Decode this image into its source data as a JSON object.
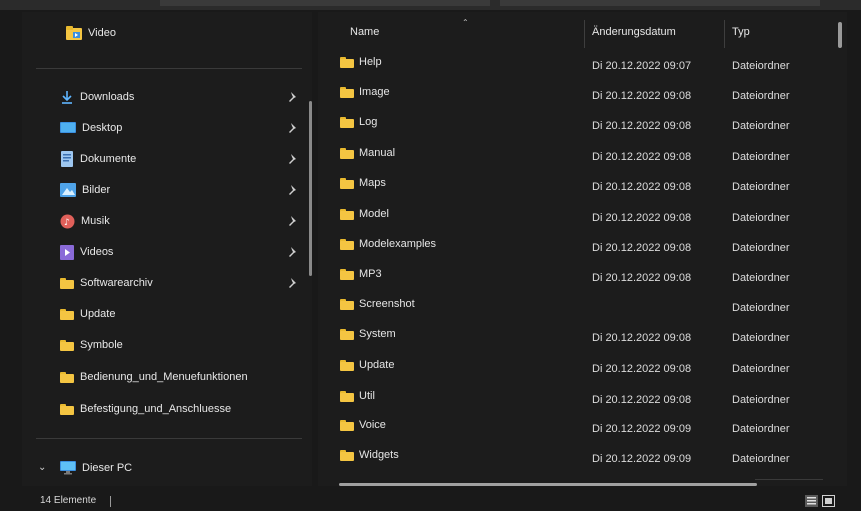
{
  "nav": {
    "top_item": {
      "label": "Video",
      "icon": "video-folder-icon"
    },
    "quick_access": [
      {
        "label": "Downloads",
        "icon": "download-arrow-icon",
        "pinned": true
      },
      {
        "label": "Desktop",
        "icon": "desktop-icon",
        "pinned": true
      },
      {
        "label": "Dokumente",
        "icon": "document-icon",
        "pinned": true
      },
      {
        "label": "Bilder",
        "icon": "pictures-icon",
        "pinned": true
      },
      {
        "label": "Musik",
        "icon": "music-icon",
        "pinned": true
      },
      {
        "label": "Videos",
        "icon": "videos-icon",
        "pinned": true
      },
      {
        "label": "Softwarearchiv",
        "icon": "folder-icon",
        "pinned": true
      },
      {
        "label": "Update",
        "icon": "folder-icon",
        "pinned": false
      },
      {
        "label": "Symbole",
        "icon": "folder-icon",
        "pinned": false
      },
      {
        "label": "Bedienung_und_Menuefunktionen",
        "icon": "folder-icon",
        "pinned": false
      },
      {
        "label": "Befestigung_und_Anschluesse",
        "icon": "folder-icon",
        "pinned": false
      }
    ],
    "this_pc": {
      "label": "Dieser PC",
      "icon": "computer-icon",
      "expanded": true
    }
  },
  "columns": {
    "name": "Name",
    "date": "Änderungsdatum",
    "type": "Typ"
  },
  "files": [
    {
      "name": "Help",
      "date": "Di 20.12.2022 09:07",
      "type": "Dateiordner"
    },
    {
      "name": "Image",
      "date": "Di 20.12.2022 09:08",
      "type": "Dateiordner"
    },
    {
      "name": "Log",
      "date": "Di 20.12.2022 09:08",
      "type": "Dateiordner"
    },
    {
      "name": "Manual",
      "date": "Di 20.12.2022 09:08",
      "type": "Dateiordner"
    },
    {
      "name": "Maps",
      "date": "Di 20.12.2022 09:08",
      "type": "Dateiordner"
    },
    {
      "name": "Model",
      "date": "Di 20.12.2022 09:08",
      "type": "Dateiordner"
    },
    {
      "name": "Modelexamples",
      "date": "Di 20.12.2022 09:08",
      "type": "Dateiordner"
    },
    {
      "name": "MP3",
      "date": "Di 20.12.2022 09:08",
      "type": "Dateiordner"
    },
    {
      "name": "Screenshot",
      "date": "",
      "type": "Dateiordner"
    },
    {
      "name": "System",
      "date": "Di 20.12.2022 09:08",
      "type": "Dateiordner"
    },
    {
      "name": "Update",
      "date": "Di 20.12.2022 09:08",
      "type": "Dateiordner"
    },
    {
      "name": "Util",
      "date": "Di 20.12.2022 09:08",
      "type": "Dateiordner"
    },
    {
      "name": "Voice",
      "date": "Di 20.12.2022 09:09",
      "type": "Dateiordner"
    },
    {
      "name": "Widgets",
      "date": "Di 20.12.2022 09:09",
      "type": "Dateiordner"
    }
  ],
  "status": {
    "item_count": "14 Elemente"
  },
  "colors": {
    "background": "#191919",
    "folder": "#f4c542",
    "accent": "#3b8fe0",
    "text": "#e6e6e6"
  }
}
